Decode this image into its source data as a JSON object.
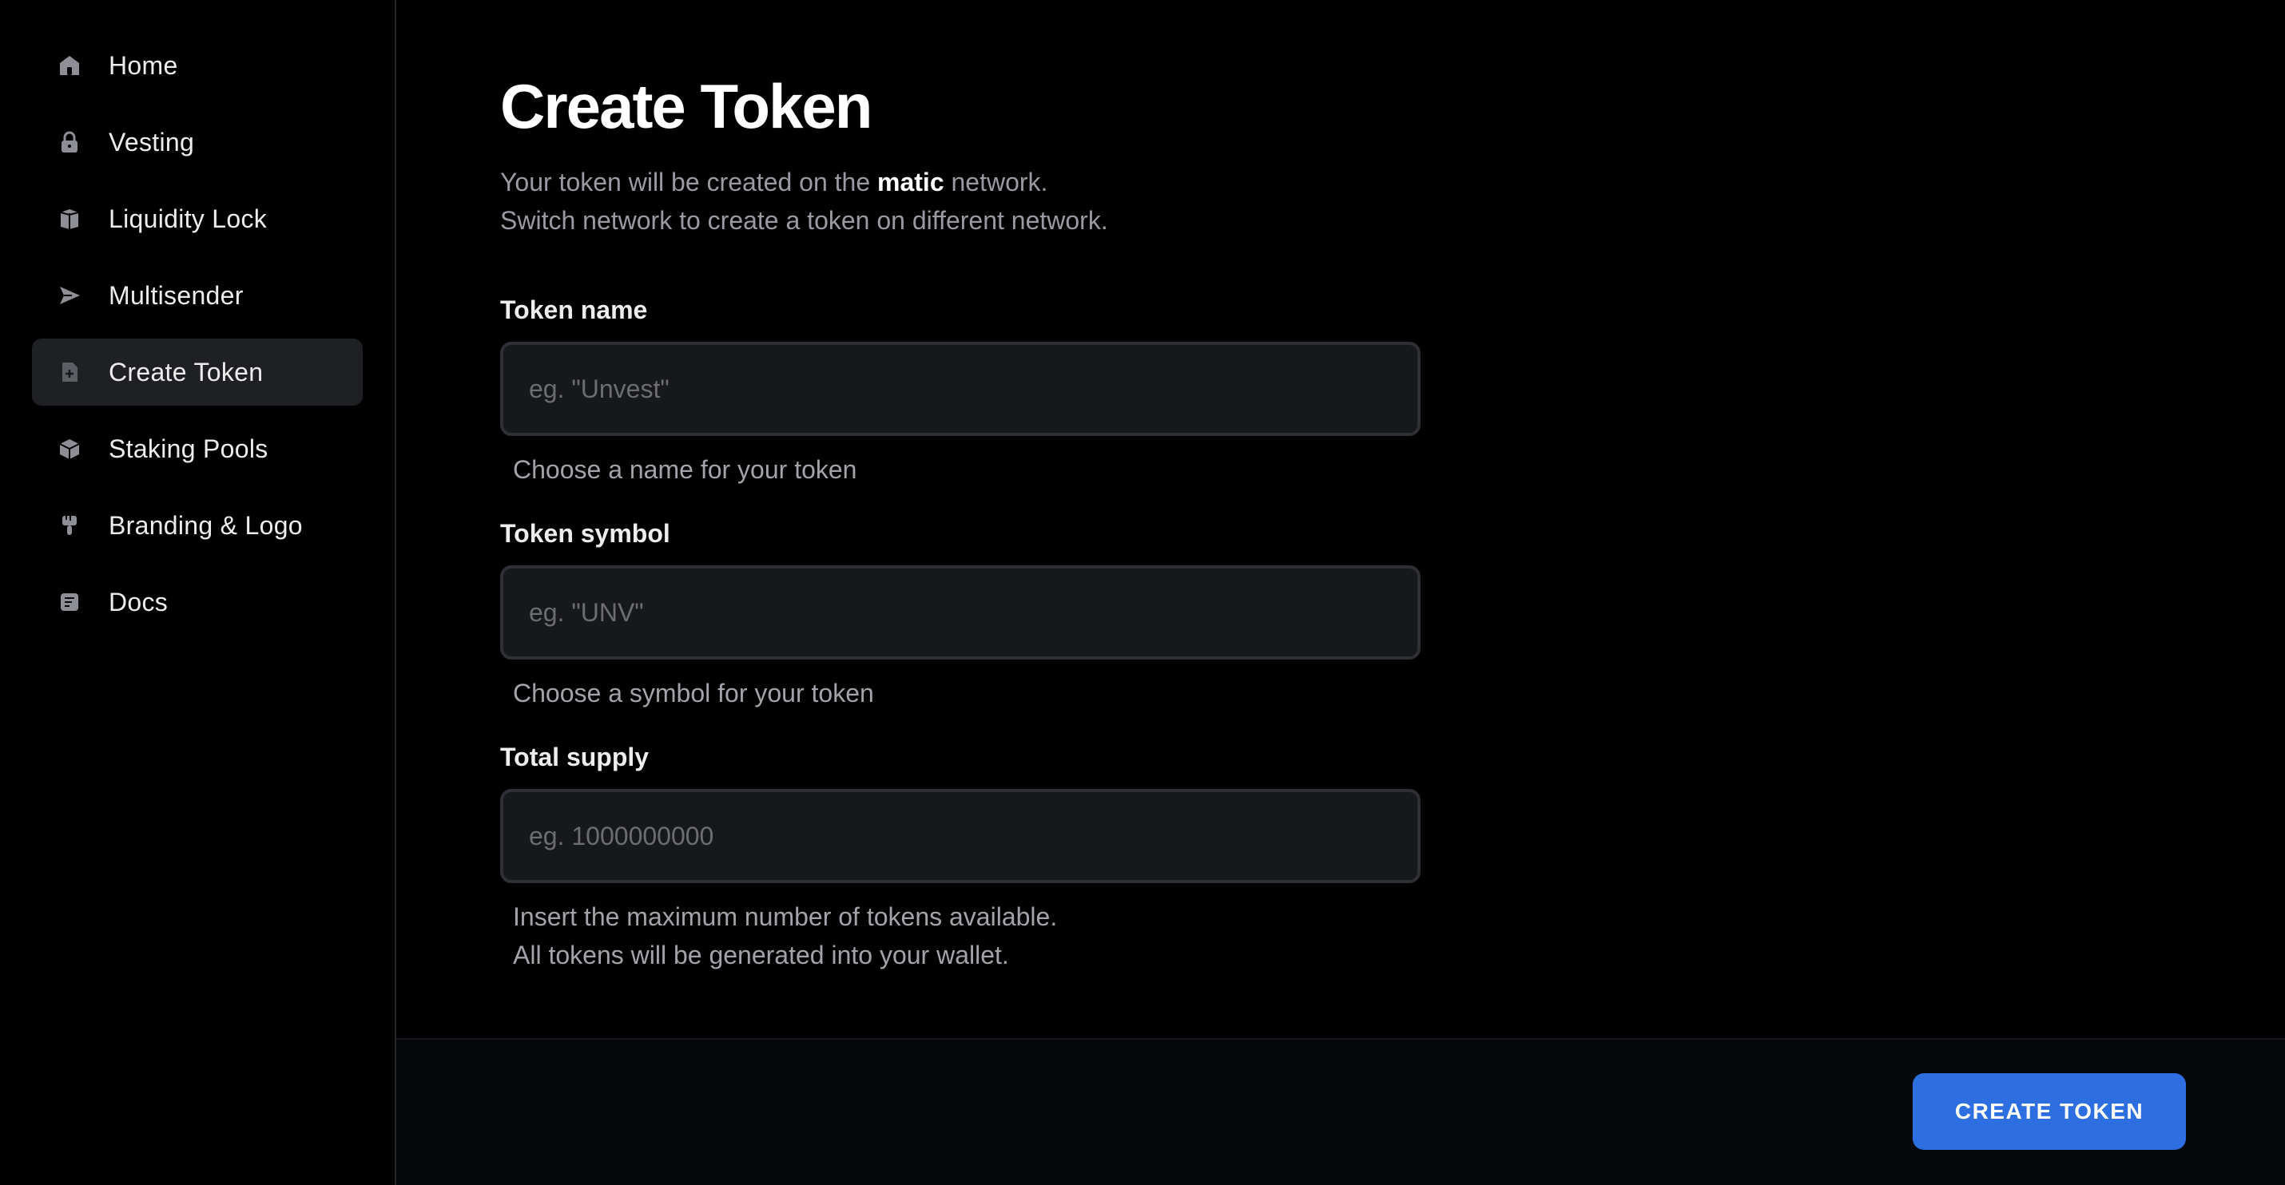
{
  "sidebar": {
    "items": [
      {
        "label": "Home",
        "icon": "home-icon"
      },
      {
        "label": "Vesting",
        "icon": "lock-icon"
      },
      {
        "label": "Liquidity Lock",
        "icon": "box-icon"
      },
      {
        "label": "Multisender",
        "icon": "send-icon"
      },
      {
        "label": "Create Token",
        "icon": "document-add-icon",
        "active": true
      },
      {
        "label": "Staking Pools",
        "icon": "cube-icon"
      },
      {
        "label": "Branding & Logo",
        "icon": "brush-icon"
      },
      {
        "label": "Docs",
        "icon": "docs-icon"
      }
    ]
  },
  "main": {
    "title": "Create Token",
    "subtitle": {
      "line1_prefix": "Your token will be created on the ",
      "network": "matic",
      "line1_suffix": " network.",
      "line2": "Switch network to create a token on different network."
    },
    "fields": {
      "name": {
        "label": "Token name",
        "placeholder": "eg. \"Unvest\"",
        "value": "",
        "help": "Choose a name for your token"
      },
      "symbol": {
        "label": "Token symbol",
        "placeholder": "eg. \"UNV\"",
        "value": "",
        "help": "Choose a symbol for your token"
      },
      "supply": {
        "label": "Total supply",
        "placeholder": "eg. 1000000000",
        "value": "",
        "help_line1": "Insert the maximum number of tokens available.",
        "help_line2": "All tokens will be generated into your wallet."
      }
    }
  },
  "footer": {
    "create_button": "CREATE TOKEN"
  },
  "colors": {
    "background": "#000000",
    "accent": "#2d6ee0",
    "input_bg": "#17181b",
    "active_nav_bg": "#1f2023"
  }
}
